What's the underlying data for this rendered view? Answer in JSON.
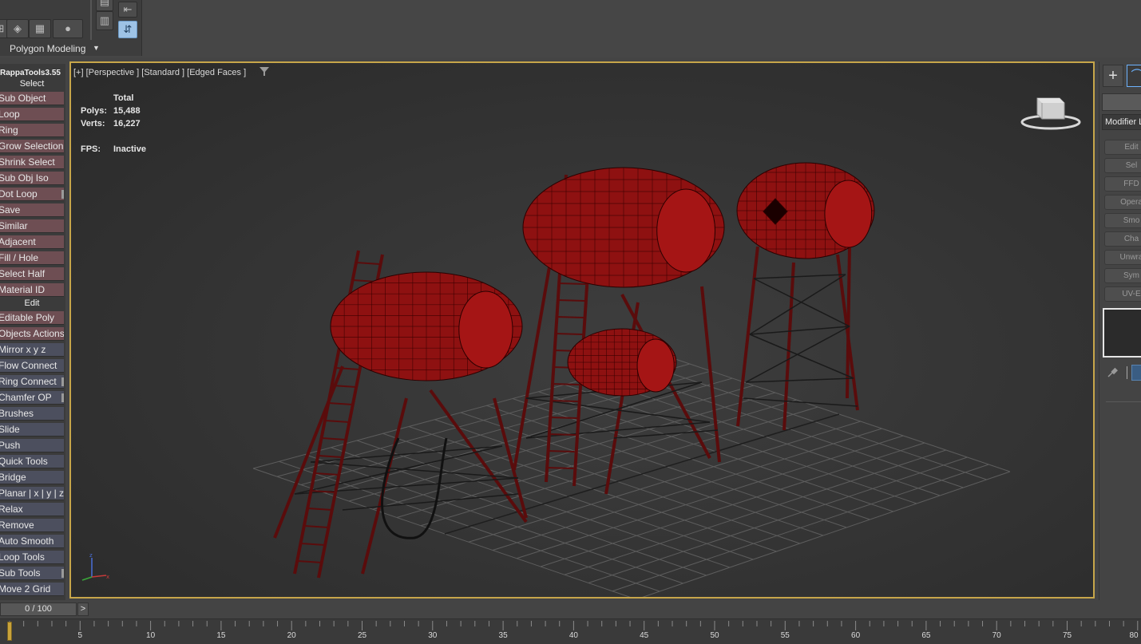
{
  "ribbon": {
    "title": "Polygon Modeling"
  },
  "left_panel": {
    "title": "RappaTools3.55",
    "section_select": "Select",
    "section_edit": "Edit",
    "select_tools": [
      {
        "label": "Sub Object",
        "edge": false
      },
      {
        "label": "Loop",
        "edge": false
      },
      {
        "label": "Ring",
        "edge": false
      },
      {
        "label": "Grow Selection",
        "edge": false
      },
      {
        "label": "Shrink Select",
        "edge": false
      },
      {
        "label": "Sub Obj Iso",
        "edge": false
      },
      {
        "label": "Dot Loop",
        "edge": true
      },
      {
        "label": " Save",
        "edge": false
      },
      {
        "label": "Similar",
        "edge": false
      },
      {
        "label": "Adjacent",
        "edge": false
      },
      {
        "label": "Fill / Hole",
        "edge": false
      },
      {
        "label": "Select Half",
        "edge": false
      },
      {
        "label": "Material ID",
        "edge": false
      }
    ],
    "edit_tools": [
      {
        "label": "Editable Poly",
        "edge": false,
        "style": "red"
      },
      {
        "label": "Objects Actions",
        "edge": false,
        "style": "red"
      },
      {
        "label": "Mirror    x  y  z",
        "edge": false,
        "style": "blue"
      },
      {
        "label": "Flow Connect",
        "edge": false,
        "style": "blue"
      },
      {
        "label": "Ring Connect",
        "edge": true,
        "style": "blue"
      },
      {
        "label": "Chamfer OP",
        "edge": true,
        "style": "blue"
      },
      {
        "label": "Brushes",
        "edge": false,
        "style": "blue"
      },
      {
        "label": "Slide",
        "edge": false,
        "style": "blue"
      },
      {
        "label": "Push",
        "edge": false,
        "style": "blue"
      },
      {
        "label": "Quick Tools",
        "edge": false,
        "style": "blue"
      },
      {
        "label": "Bridge",
        "edge": false,
        "style": "blue"
      },
      {
        "label": "Planar | x | y | z",
        "edge": false,
        "style": "blue"
      },
      {
        "label": "Relax",
        "edge": false,
        "style": "blue"
      },
      {
        "label": "Remove",
        "edge": false,
        "style": "blue"
      },
      {
        "label": "Auto Smooth",
        "edge": false,
        "style": "blue"
      },
      {
        "label": "Loop Tools",
        "edge": false,
        "style": "blue"
      },
      {
        "label": "Sub Tools",
        "edge": true,
        "style": "blue"
      },
      {
        "label": "Move 2 Grid",
        "edge": false,
        "style": "blue"
      }
    ]
  },
  "viewport": {
    "label": "[+] [Perspective ] [Standard ] [Edged Faces ]",
    "stats": {
      "header": "Total",
      "polys_label": "Polys:",
      "polys_value": "15,488",
      "verts_label": "Verts:",
      "verts_value": "16,227",
      "fps_label": "FPS:",
      "fps_value": "Inactive"
    },
    "accent_color": "#c7a64a",
    "tank_color": "#8e1111"
  },
  "right_panel": {
    "modifier_list": "Modifier List",
    "modifier_buttons": [
      "Edit",
      "Sel",
      "FFD",
      "Opera",
      "Smo",
      "Cha",
      "Unwra",
      "Sym",
      "UV-E"
    ]
  },
  "timeline": {
    "frame_display": "0 / 100",
    "next_label": ">",
    "ticks": [
      "5",
      "10",
      "15",
      "20",
      "25",
      "30",
      "35",
      "40",
      "45",
      "50",
      "55",
      "60",
      "65",
      "70",
      "75",
      "80"
    ]
  }
}
